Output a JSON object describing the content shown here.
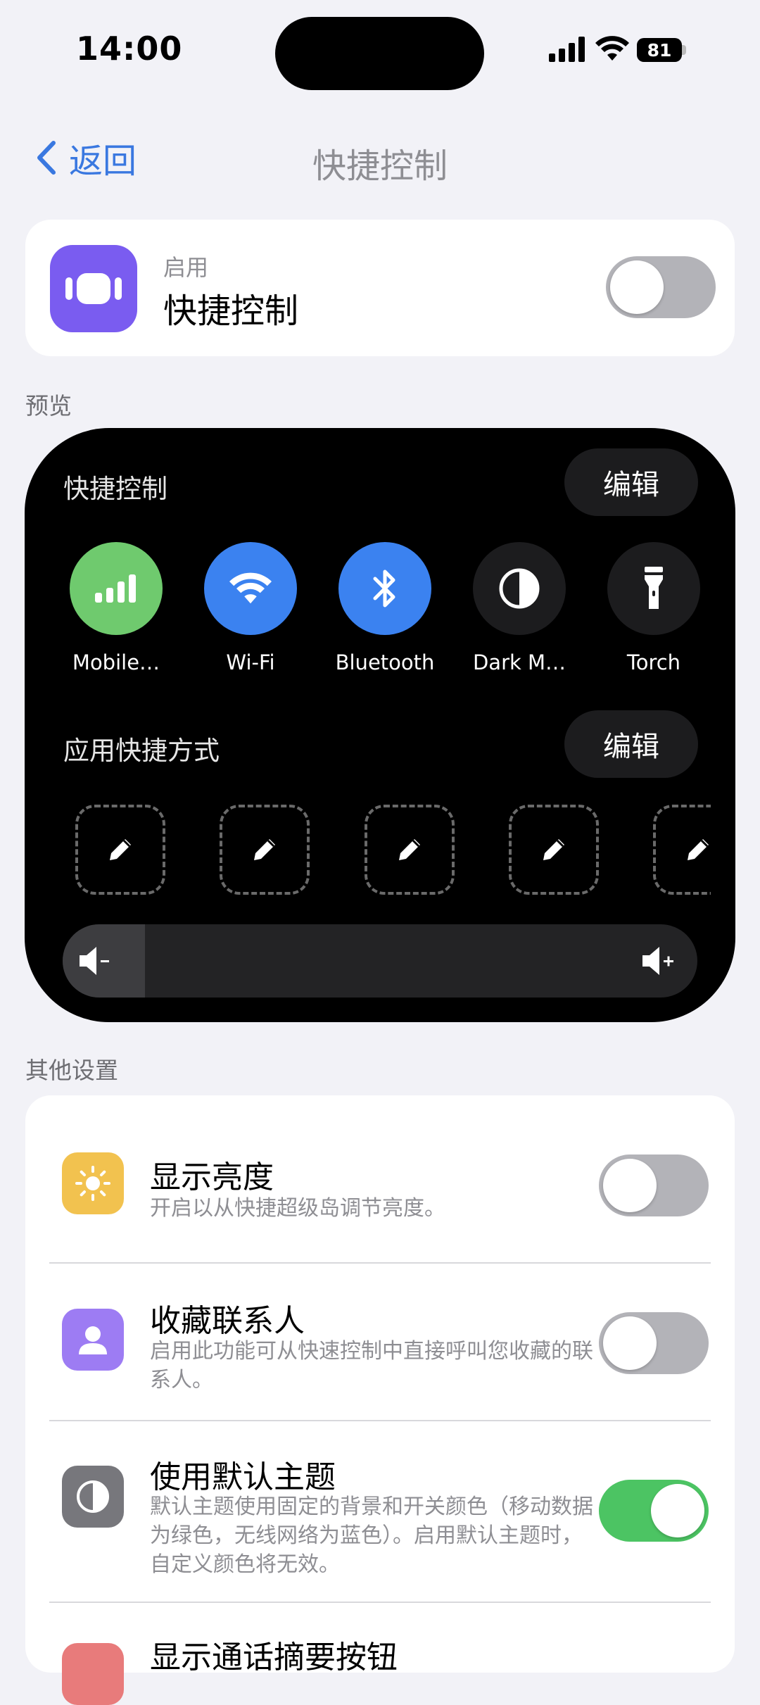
{
  "status_bar": {
    "time": "14:00",
    "battery": "81"
  },
  "nav": {
    "back_label": "返回",
    "title": "快捷控制"
  },
  "enable": {
    "small_label": "启用",
    "title": "快捷控制",
    "toggle_on": false
  },
  "preview_section": {
    "label": "预览",
    "quick_controls_label": "快捷控制",
    "edit_label": "编辑",
    "controls": [
      {
        "label": "Mobile…",
        "icon": "cellular-icon",
        "color": "#6fca6e"
      },
      {
        "label": "Wi-Fi",
        "icon": "wifi-icon",
        "color": "#3b82f0"
      },
      {
        "label": "Bluetooth",
        "icon": "bluetooth-icon",
        "color": "#3b82f0"
      },
      {
        "label": "Dark M…",
        "icon": "dark-mode-icon",
        "color": "#1c1c1e"
      },
      {
        "label": "Torch",
        "icon": "torch-icon",
        "color": "#1c1c1e"
      }
    ],
    "app_shortcuts_label": "应用快捷方式",
    "app_shortcuts_edit_label": "编辑",
    "volume_level": 0.13
  },
  "other_settings": {
    "label": "其他设置",
    "rows": [
      {
        "title": "显示亮度",
        "desc": "开启以从快捷超级岛调节亮度。",
        "icon": "brightness-icon",
        "color": "#f2c24f",
        "toggle_on": false
      },
      {
        "title": "收藏联系人",
        "desc": "启用此功能可从快速控制中直接呼叫您收藏的联系人。",
        "icon": "contact-icon",
        "color": "#9d7cf3",
        "toggle_on": false
      },
      {
        "title": "使用默认主题",
        "desc": "默认主题使用固定的背景和开关颜色（移动数据为绿色，无线网络为蓝色）。启用默认主题时，自定义颜色将无效。",
        "icon": "theme-icon",
        "color": "#77777c",
        "toggle_on": true
      },
      {
        "title": "显示通话摘要按钮",
        "icon": "call-summary-icon",
        "color": "#e87b7b"
      }
    ]
  }
}
